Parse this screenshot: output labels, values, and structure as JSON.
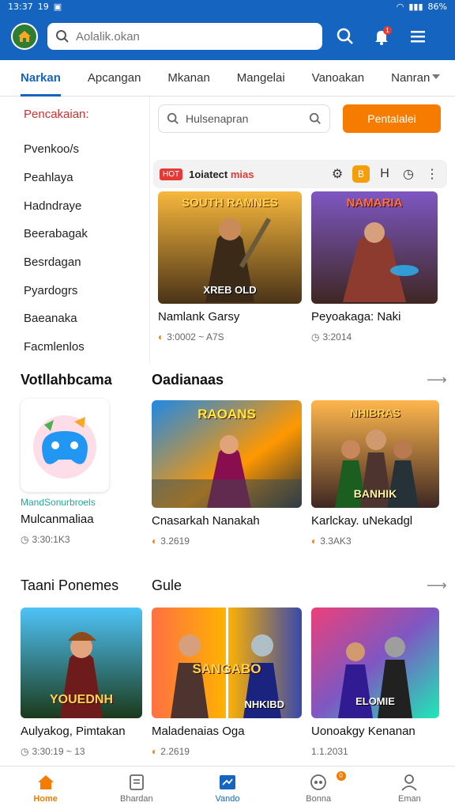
{
  "status_bar": {
    "time": "13:37",
    "sim": "19",
    "battery": "86%"
  },
  "header": {
    "search_placeholder": "Aolalik.okan"
  },
  "tabs": [
    {
      "label": "Narkan"
    },
    {
      "label": "Apcangan"
    },
    {
      "label": "Mkanan"
    },
    {
      "label": "Mangelai"
    },
    {
      "label": "Vanoakan"
    },
    {
      "label": "Nanran"
    }
  ],
  "sidebar": {
    "heading": "Pencakaian:",
    "items": [
      "Pvenkoo/s",
      "Peahlaya",
      "Hadndraye",
      "Beerabagak",
      "Besrdagan",
      "Pyardogrs",
      "Baeanaka",
      "Facmlenlos"
    ]
  },
  "filter": {
    "search_placeholder": "Hulsenapran",
    "button_label": "Pentalalei"
  },
  "featured": {
    "hot_tag": "HOT",
    "title_prefix": "1oiatect ",
    "title_red": "mias",
    "orange_chip": "B",
    "tool_icon": "H",
    "cards": [
      {
        "art_text": "SOUTH RAMNES",
        "art_bottom": "XREB OLD",
        "title": "Namlank Garsy",
        "meta": "3:0002 ~ A7S"
      },
      {
        "art_text": "NAMARIA",
        "art_bottom": "",
        "title": "Peyoakaga: Naki",
        "meta": "3:2014"
      }
    ]
  },
  "section_left": {
    "title": "Votllahbcama",
    "app_caption": "MandSonurbroels",
    "card_title": "Mulcanmaliaa",
    "card_meta": "3:30:1K3"
  },
  "section_right": {
    "title": "Oadianaas",
    "cards": [
      {
        "art_text": "RAOANS",
        "title": "Cnasarkah Nanakah",
        "meta": "3.2619"
      },
      {
        "art_text": "NHIBRAS",
        "art_bottom": "BANHIK",
        "title": "Karlckay. uNekadgl",
        "meta": "3.3AK3"
      }
    ]
  },
  "section_bottom": {
    "title_left": "Taani Ponemes",
    "title_right": "Gule",
    "cards": [
      {
        "art_text": "YOUEDNH",
        "title": "Aulyakog, Pimtakan",
        "meta": "3:30:19 ~ 13"
      },
      {
        "art_text": "SANGABO",
        "art_bottom": "NHKIBD",
        "title": "Maladenaias Oga",
        "meta": "2.2619"
      },
      {
        "art_text": "ELOMIE",
        "title": "Uonoakgy Kenanan",
        "meta": "1.1.2031"
      }
    ]
  },
  "bottom_nav": [
    {
      "label": "Home"
    },
    {
      "label": "Bhardan"
    },
    {
      "label": "Vando"
    },
    {
      "label": "Bonna",
      "badge": "0"
    },
    {
      "label": "Eman"
    }
  ],
  "colors": {
    "primary": "#1565c0",
    "accent": "#f57c00",
    "red": "#e53935"
  }
}
